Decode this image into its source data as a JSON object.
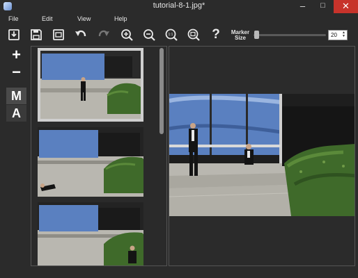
{
  "window": {
    "title": "tutorial-8-1.jpg*",
    "minimize_glyph": "–",
    "maximize_glyph": "□",
    "close_glyph": "✕"
  },
  "menu": [
    {
      "label": "File"
    },
    {
      "label": "Edit"
    },
    {
      "label": "View"
    },
    {
      "label": "Help"
    }
  ],
  "toolbar": {
    "icons": [
      "import-icon",
      "save-icon",
      "export-icon",
      "undo-icon",
      "redo-icon",
      "zoom-in-icon",
      "zoom-out-icon",
      "zoom-actual-icon",
      "zoom-fit-icon",
      "help-icon"
    ],
    "help_glyph": "?",
    "marker_label_1": "Marker",
    "marker_label_2": "Size",
    "marker_size_value": "20"
  },
  "left_tools": {
    "add_glyph": "+",
    "remove_glyph": "−",
    "mode_manual": "M",
    "mode_auto": "A"
  },
  "thumbnails": [
    {
      "name": "thumbnail-1",
      "selected": true
    },
    {
      "name": "thumbnail-2",
      "selected": false
    },
    {
      "name": "thumbnail-3",
      "selected": false
    }
  ],
  "colors": {
    "background": "#2b2b2b",
    "close_button": "#c7332b",
    "sky": "#5a80c0",
    "building": "#1d1d1d",
    "concrete": "#b9b7b0",
    "hedge": "#3f6a2a"
  }
}
